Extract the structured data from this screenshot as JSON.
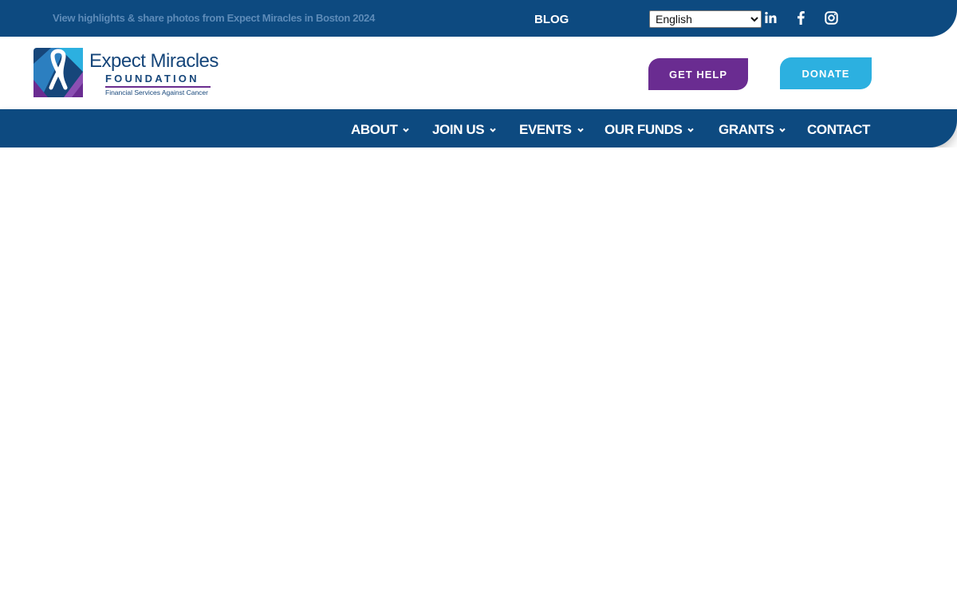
{
  "topbar": {
    "banner_text": "View highlights & share photos from Expect Miracles in Boston 2024",
    "blog_label": "BLOG",
    "language": {
      "selected": "English",
      "options": [
        "English"
      ]
    },
    "social_icons": [
      "linkedin-icon",
      "facebook-icon",
      "instagram-icon"
    ]
  },
  "header": {
    "logo": {
      "title": "Expect Miracles",
      "subtitle": "FOUNDATION",
      "tagline": "Financial Services Against Cancer"
    },
    "get_help_label": "GET HELP",
    "donate_label": "DONATE"
  },
  "nav": {
    "items": [
      {
        "label": "ABOUT",
        "has_dropdown": true
      },
      {
        "label": "JOIN US",
        "has_dropdown": true
      },
      {
        "label": "EVENTS",
        "has_dropdown": true
      },
      {
        "label": "OUR FUNDS",
        "has_dropdown": true
      },
      {
        "label": "GRANTS",
        "has_dropdown": true
      },
      {
        "label": "CONTACT",
        "has_dropdown": false
      }
    ]
  },
  "colors": {
    "navy": "#0d4a80",
    "purple": "#6a2c91",
    "cyan": "#2cb0e0",
    "banner_text": "#5d8bb8"
  }
}
